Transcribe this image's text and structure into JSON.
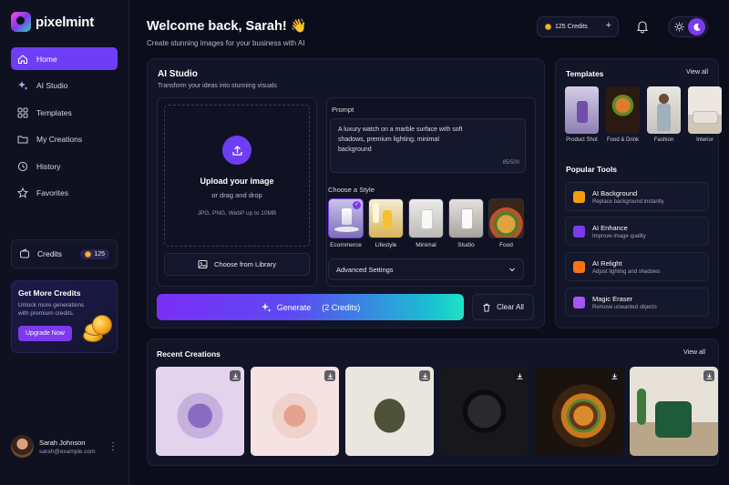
{
  "brand": {
    "name": "pixelmint"
  },
  "nav": [
    {
      "label": "Home",
      "icon": "home-icon"
    },
    {
      "label": "AI Studio",
      "icon": "sparkle-icon"
    },
    {
      "label": "Templates",
      "icon": "grid-icon"
    },
    {
      "label": "My Creations",
      "icon": "folder-icon"
    },
    {
      "label": "History",
      "icon": "history-icon"
    },
    {
      "label": "Favorites",
      "icon": "star-icon"
    }
  ],
  "sidebar_credits": {
    "label": "Credits",
    "value": "125"
  },
  "promo": {
    "title": "Get More Credits",
    "text": "Unlock more generations with premium credits.",
    "button": "Upgrade Now"
  },
  "user": {
    "name": "Sarah Johnson",
    "email": "sarah@example.com"
  },
  "header": {
    "title": "Welcome back, Sarah! 👋",
    "subtitle": "Create stunning images for your business with AI",
    "credits": "125 Credits"
  },
  "studio": {
    "title": "AI Studio",
    "subtitle": "Transform your ideas into stunning visuals",
    "upload": {
      "title": "Upload your image",
      "or": "or drag and drop",
      "formats": "JPG, PNG, WebP up to 10MB",
      "library_button": "Choose from Library"
    },
    "prompt": {
      "label": "Prompt",
      "value": "A luxury watch on a marble surface with soft shadows, premium lighting, minimal background",
      "counter": "85/500"
    },
    "style_label": "Choose a Style",
    "styles": [
      {
        "label": "Ecommerce",
        "selected": true
      },
      {
        "label": "Lifestyle"
      },
      {
        "label": "Minimal"
      },
      {
        "label": "Studio"
      },
      {
        "label": "Food"
      }
    ],
    "advanced": "Advanced Settings",
    "generate": {
      "label": "Generate",
      "credits": "(2 Credits)"
    },
    "clear": "Clear All"
  },
  "templates": {
    "title": "Templates",
    "view_all": "View all",
    "items": [
      {
        "label": "Product Shot"
      },
      {
        "label": "Food & Drink"
      },
      {
        "label": "Fashion"
      },
      {
        "label": "Interior"
      }
    ]
  },
  "popular": {
    "title": "Popular Tools",
    "items": [
      {
        "name": "AI Background",
        "desc": "Replace background instantly",
        "color": "#f59e0b"
      },
      {
        "name": "AI Enhance",
        "desc": "Improve image quality",
        "color": "#7c3aed"
      },
      {
        "name": "AI Relight",
        "desc": "Adjust lighting and shadows",
        "color": "#f97316"
      },
      {
        "name": "Magic Eraser",
        "desc": "Remove unwanted objects",
        "color": "#a855f7"
      }
    ]
  },
  "recent": {
    "title": "Recent Creations",
    "view_all": "View all",
    "items": [
      "perfume-purple",
      "perfume-pink",
      "handbag",
      "headphones",
      "burger",
      "armchair"
    ]
  }
}
